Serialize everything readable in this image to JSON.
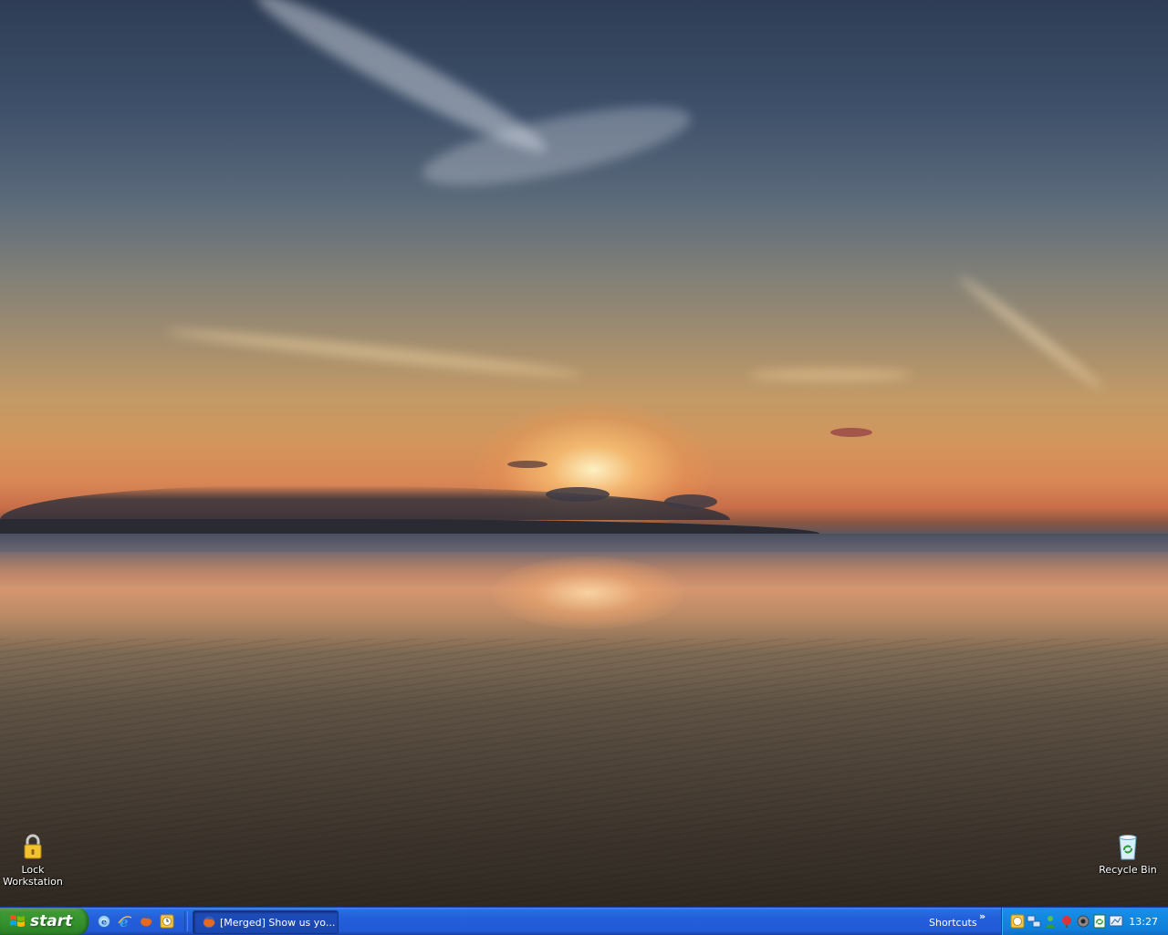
{
  "desktop": {
    "icons": [
      {
        "label": "Lock Workstation",
        "icon": "padlock-icon"
      },
      {
        "label": "Recycle Bin",
        "icon": "recycle-bin-icon"
      }
    ]
  },
  "taskbar": {
    "start_label": "start",
    "quick_launch": [
      "internet-explorer-icon",
      "ie-browser-icon",
      "firefox-icon",
      "clock-app-icon"
    ],
    "active_task": {
      "label": "[Merged] Show us yo...",
      "icon": "firefox-icon"
    },
    "shortcuts_label": "Shortcuts",
    "shortcuts_chevron": "»",
    "tray_icons": [
      "clock-app-icon",
      "network-icon",
      "messenger-icon",
      "antivirus-icon",
      "shield-icon",
      "sync-icon",
      "display-icon"
    ],
    "clock": "13:27"
  },
  "colors": {
    "taskbar_blue": "#245edb",
    "start_green": "#3c9a34",
    "tray_blue": "#138ae3"
  }
}
